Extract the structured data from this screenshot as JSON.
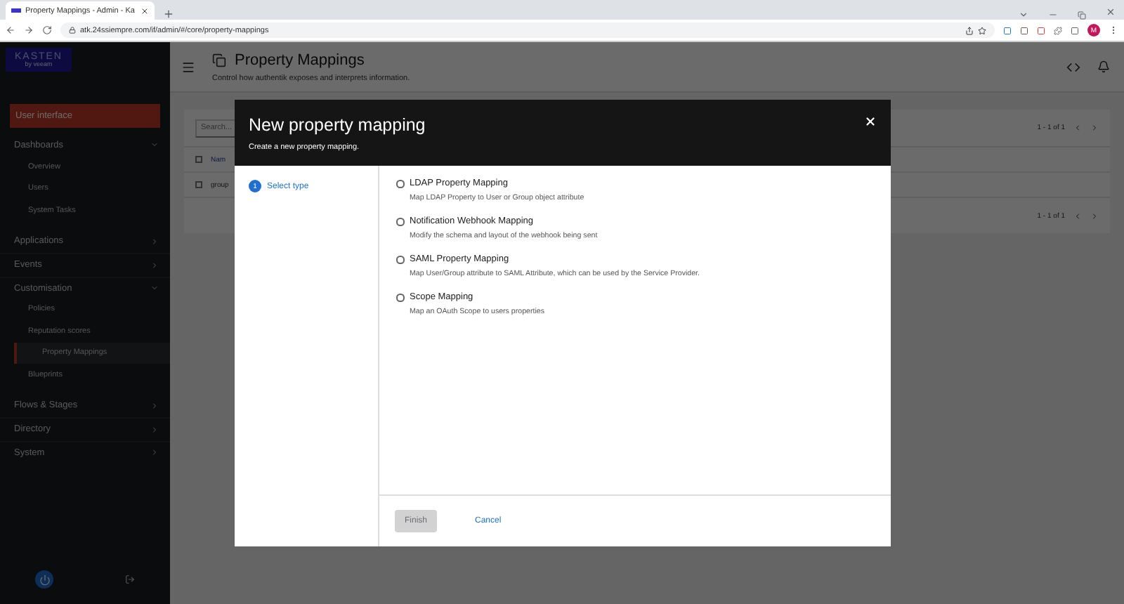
{
  "browser": {
    "tab": {
      "title": "Property Mappings - Admin - Ka",
      "selected": true
    },
    "url": "atk.24ssiempre.com/if/admin/#/core/property-mappings",
    "avatar": "M"
  },
  "sidebar": {
    "logo": {
      "name": "KASTEN",
      "tagline": "by veeam"
    },
    "items": [
      {
        "kind": "button",
        "label": "User interface"
      },
      {
        "kind": "group",
        "label": "Dashboards",
        "expanded": true,
        "children": [
          {
            "label": "Overview",
            "selected": false
          },
          {
            "label": "Users",
            "selected": false
          },
          {
            "label": "System Tasks",
            "selected": false
          }
        ]
      },
      {
        "kind": "group",
        "label": "Applications",
        "expanded": false
      },
      {
        "kind": "group",
        "label": "Events",
        "expanded": false
      },
      {
        "kind": "group",
        "label": "Customisation",
        "expanded": true,
        "children": [
          {
            "label": "Policies",
            "selected": false
          },
          {
            "label": "Reputation scores",
            "selected": false
          },
          {
            "label": "Property Mappings",
            "selected": true
          },
          {
            "label": "Blueprints",
            "selected": false
          }
        ]
      },
      {
        "kind": "group",
        "label": "Flows & Stages",
        "expanded": false
      },
      {
        "kind": "group",
        "label": "Directory",
        "expanded": false
      },
      {
        "kind": "group",
        "label": "System",
        "expanded": false
      }
    ]
  },
  "page": {
    "title": "Property Mappings",
    "subtitle": "Control how authentik exposes and interprets information.",
    "search": {
      "placeholder": "Search..."
    },
    "pagination_top": "1 - 1 of 1",
    "column_header": "Nam",
    "header_checked": false,
    "row_cell": "group",
    "row_checked": false,
    "pagination_bottom": "1 - 1 of 1"
  },
  "modal": {
    "title": "New property mapping",
    "subtitle": "Create a new property mapping.",
    "steps": [
      {
        "number": "1",
        "label": "Select type",
        "selected": true
      }
    ],
    "options": [
      {
        "title": "LDAP Property Mapping",
        "description": "Map LDAP Property to User or Group object attribute",
        "selected": false
      },
      {
        "title": "Notification Webhook Mapping",
        "description": "Modify the schema and layout of the webhook being sent",
        "selected": false
      },
      {
        "title": "SAML Property Mapping",
        "description": "Map User/Group attribute to SAML Attribute, which can be used by the Service Provider.",
        "selected": false
      },
      {
        "title": "Scope Mapping",
        "description": "Map an OAuth Scope to users properties",
        "selected": false
      }
    ],
    "finish": {
      "label": "Finish",
      "disabled": true
    },
    "cancel": "Cancel"
  }
}
